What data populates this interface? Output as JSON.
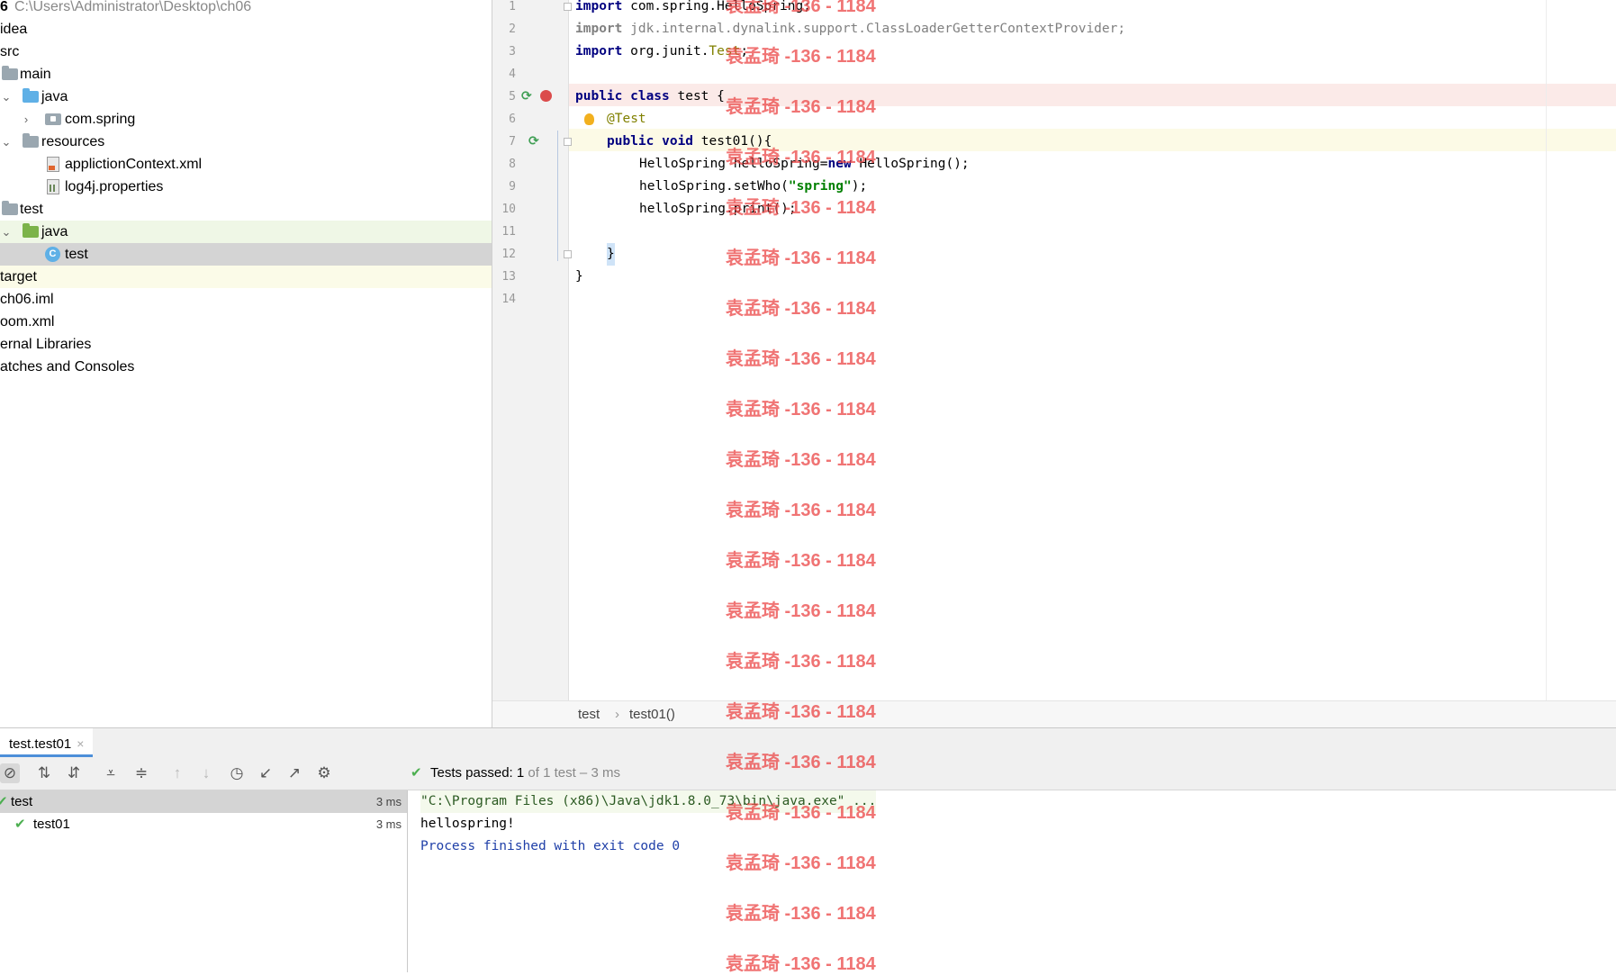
{
  "project": {
    "header": {
      "prefix": "6",
      "path": "C:\\Users\\Administrator\\Desktop\\ch06"
    },
    "items": [
      {
        "label": "idea"
      },
      {
        "label": "src"
      },
      {
        "label": "main"
      },
      {
        "label": "java"
      },
      {
        "label": "com.spring"
      },
      {
        "label": "resources"
      },
      {
        "label": "applictionContext.xml"
      },
      {
        "label": "log4j.properties"
      },
      {
        "label": "test"
      },
      {
        "label": "java"
      },
      {
        "label": "test"
      },
      {
        "label": "target"
      },
      {
        "label": "ch06.iml"
      },
      {
        "label": "oom.xml"
      },
      {
        "label": "ernal Libraries"
      },
      {
        "label": "atches and Consoles"
      }
    ]
  },
  "editor": {
    "line_numbers": [
      "1",
      "2",
      "3",
      "4",
      "5",
      "6",
      "7",
      "8",
      "9",
      "10",
      "11",
      "12",
      "13",
      "14"
    ],
    "code": {
      "l1_kw": "import",
      "l1_rest": " com.spring.HelloSpring;",
      "l2_kw": "import",
      "l2_rest": " jdk.internal.dynalink.support.ClassLoaderGetterContextProvider;",
      "l3_kw": "import",
      "l3_a": " org.junit.",
      "l3_b": "Test",
      "l3_c": ";",
      "l5_kw": "public class",
      "l5_rest": " test {",
      "l6": "@Test",
      "l7_kw": "public void",
      "l7_rest": " test01(){",
      "l8_a": "HelloSpring helloSpring=",
      "l8_kw": "new",
      "l8_b": " HelloSpring();",
      "l9_a": "helloSpring.setWho(",
      "l9_str": "\"spring\"",
      "l9_b": ");",
      "l10": "helloSpring.print();",
      "l12": "}",
      "l13": "}"
    },
    "breadcrumbs": [
      "test",
      "test01()"
    ],
    "breadcrumb_sep": "›"
  },
  "run": {
    "tab_label": "test.test01",
    "tab_close": "×",
    "status": {
      "check": "✔",
      "prefix": "Tests passed: ",
      "passed": "1",
      "suffix": " of 1 test – 3 ms"
    },
    "tree": [
      {
        "label": "test",
        "time": "3 ms"
      },
      {
        "label": "test01",
        "time": "3 ms"
      }
    ],
    "console": [
      "\"C:\\Program Files (x86)\\Java\\jdk1.8.0_73\\bin\\java.exe\" ...",
      "hellospring!",
      "Process finished with exit code 0"
    ]
  },
  "watermark": "袁孟琦 -136 - 1184",
  "colors": {
    "keyword": "#000080",
    "string": "#008000",
    "annotation": "#808000",
    "pass": "#4caf50",
    "breakpoint": "#db4b4b"
  }
}
